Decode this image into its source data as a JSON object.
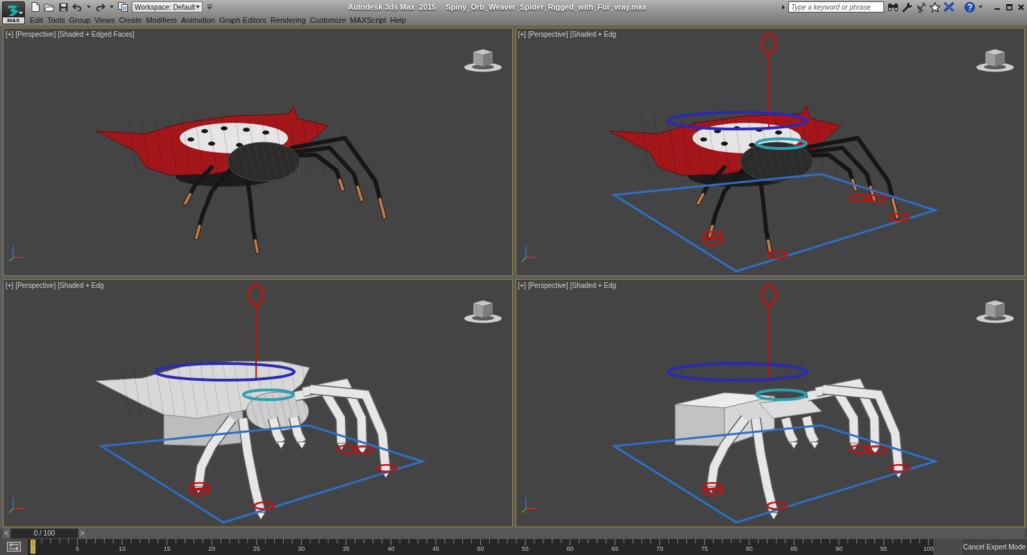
{
  "app_button": {
    "label": "MAX"
  },
  "quick_access": {
    "workspace": "Workspace: Default"
  },
  "title": {
    "app": "Autodesk 3ds Max  2015",
    "file": "Spiny_Orb_Weaver_Spider_Rigged_with_Fur_vray.max"
  },
  "search": {
    "placeholder": "Type a keyword or phrase"
  },
  "menu": [
    "Edit",
    "Tools",
    "Group",
    "Views",
    "Create",
    "Modifiers",
    "Animation",
    "Graph Editors",
    "Rendering",
    "Customize",
    "MAXScript",
    "Help"
  ],
  "viewports": [
    {
      "labels": [
        "[+]",
        "[Perspective]",
        "[Shaded + Edged Faces]"
      ],
      "kind": "textured",
      "rig_controls": false
    },
    {
      "labels": [
        "[+]",
        "[Perspective]",
        "[Shaded + Edg"
      ],
      "kind": "textured",
      "rig_controls": true
    },
    {
      "labels": [
        "[+]",
        "[Perspective]",
        "[Shaded + Edg"
      ],
      "kind": "mesh",
      "rig_controls": true
    },
    {
      "labels": [
        "[+]",
        "[Perspective]",
        "[Shaded + Edg"
      ],
      "kind": "bones",
      "rig_controls": true
    }
  ],
  "time_slider": {
    "previous": "<",
    "readout": "0 / 100",
    "next": ">",
    "level": 0
  },
  "track_bar": {
    "tick_labels": [
      "0",
      "5",
      "10",
      "15",
      "20",
      "25",
      "30",
      "35",
      "40",
      "45",
      "50",
      "55",
      "60",
      "65",
      "70",
      "75",
      "80",
      "85",
      "90",
      "95",
      "100"
    ]
  },
  "expert_mode_button": "Cancel Expert Mode"
}
